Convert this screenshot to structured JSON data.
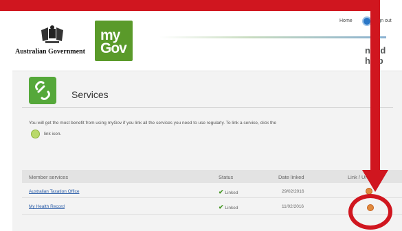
{
  "header": {
    "gov_text": "Australian Government",
    "mygov_line1": "my",
    "mygov_line2": "Gov",
    "home_label": "Home",
    "signout_label": "Sign out",
    "need_help": "need help"
  },
  "services": {
    "title": "Services",
    "intro": "You will get the most benefit from using myGov if you link all the services you need to use regularly. To link a service, click the",
    "link_icon_text": "link icon."
  },
  "table": {
    "headers": [
      "Member services",
      "Status",
      "Date linked",
      "Link / Unlink"
    ],
    "rows": [
      {
        "service": "Australian Taxation Office",
        "status": "Linked",
        "date": "29/02/2016"
      },
      {
        "service": "My Health Record",
        "status": "Linked",
        "date": "11/02/2016"
      }
    ]
  },
  "colors": {
    "annotation_red": "#d0161f",
    "mygov_green": "#5a9a2a",
    "link_blue": "#2c5ea8"
  }
}
